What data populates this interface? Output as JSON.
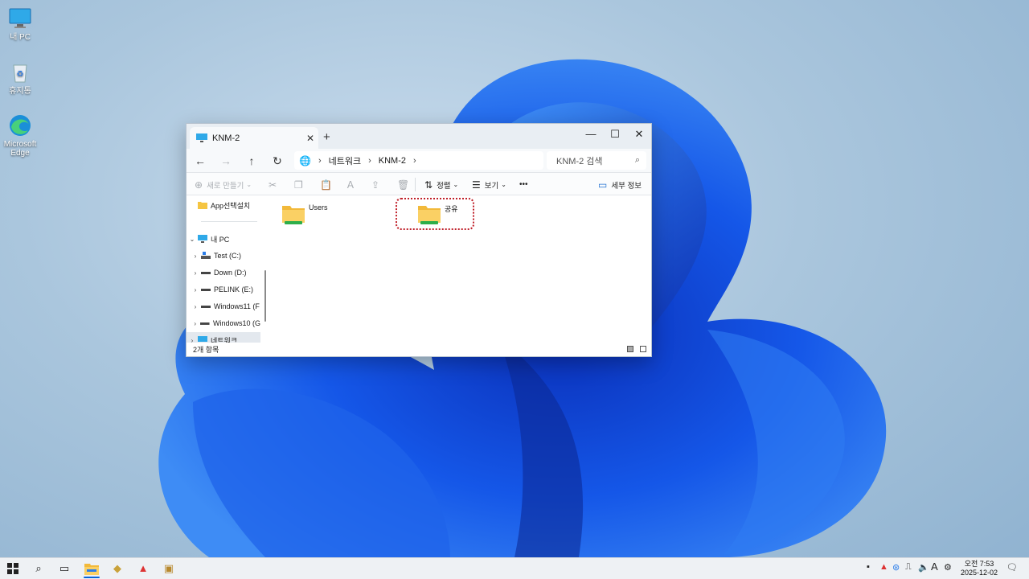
{
  "desktop": {
    "icons": [
      {
        "label": "내 PC",
        "icon": "monitor-icon"
      },
      {
        "label": "휴지통",
        "icon": "recycle-bin-icon"
      },
      {
        "label": "Microsoft Edge",
        "icon": "edge-icon"
      }
    ]
  },
  "window": {
    "tab_title": "KNM-2",
    "new_tab": "+",
    "controls": {
      "minimize": "—",
      "maximize": "☐",
      "close": "✕"
    },
    "nav": {
      "back": "←",
      "forward": "→",
      "up": "↑",
      "refresh": "↻"
    },
    "breadcrumb": [
      "네트워크",
      "KNM-2"
    ],
    "search_placeholder": "KNM-2 검색",
    "commands": {
      "new": "새로 만들기",
      "sort": "정렬",
      "view": "보기",
      "more": "•••",
      "details": "세부 정보"
    },
    "sidebar": {
      "items": [
        {
          "label": "App선택설치"
        },
        {
          "label": "내 PC"
        },
        {
          "label": "Test (C:)"
        },
        {
          "label": "Down (D:)"
        },
        {
          "label": "PELINK (E:)"
        },
        {
          "label": "Windows11 (F"
        },
        {
          "label": "Windows10 (G"
        },
        {
          "label": "네트워크"
        }
      ]
    },
    "content": {
      "items": [
        {
          "label": "Users"
        },
        {
          "label": "공유"
        }
      ]
    },
    "status": {
      "count": "2개 항목"
    }
  },
  "taskbar": {
    "clock_time": "오전 7:53",
    "clock_date": "2025-12-02",
    "ime": "A"
  },
  "colors": {
    "accent": "#0a64d8",
    "highlight_border": "#c0202a",
    "folder": "#f5c542"
  }
}
